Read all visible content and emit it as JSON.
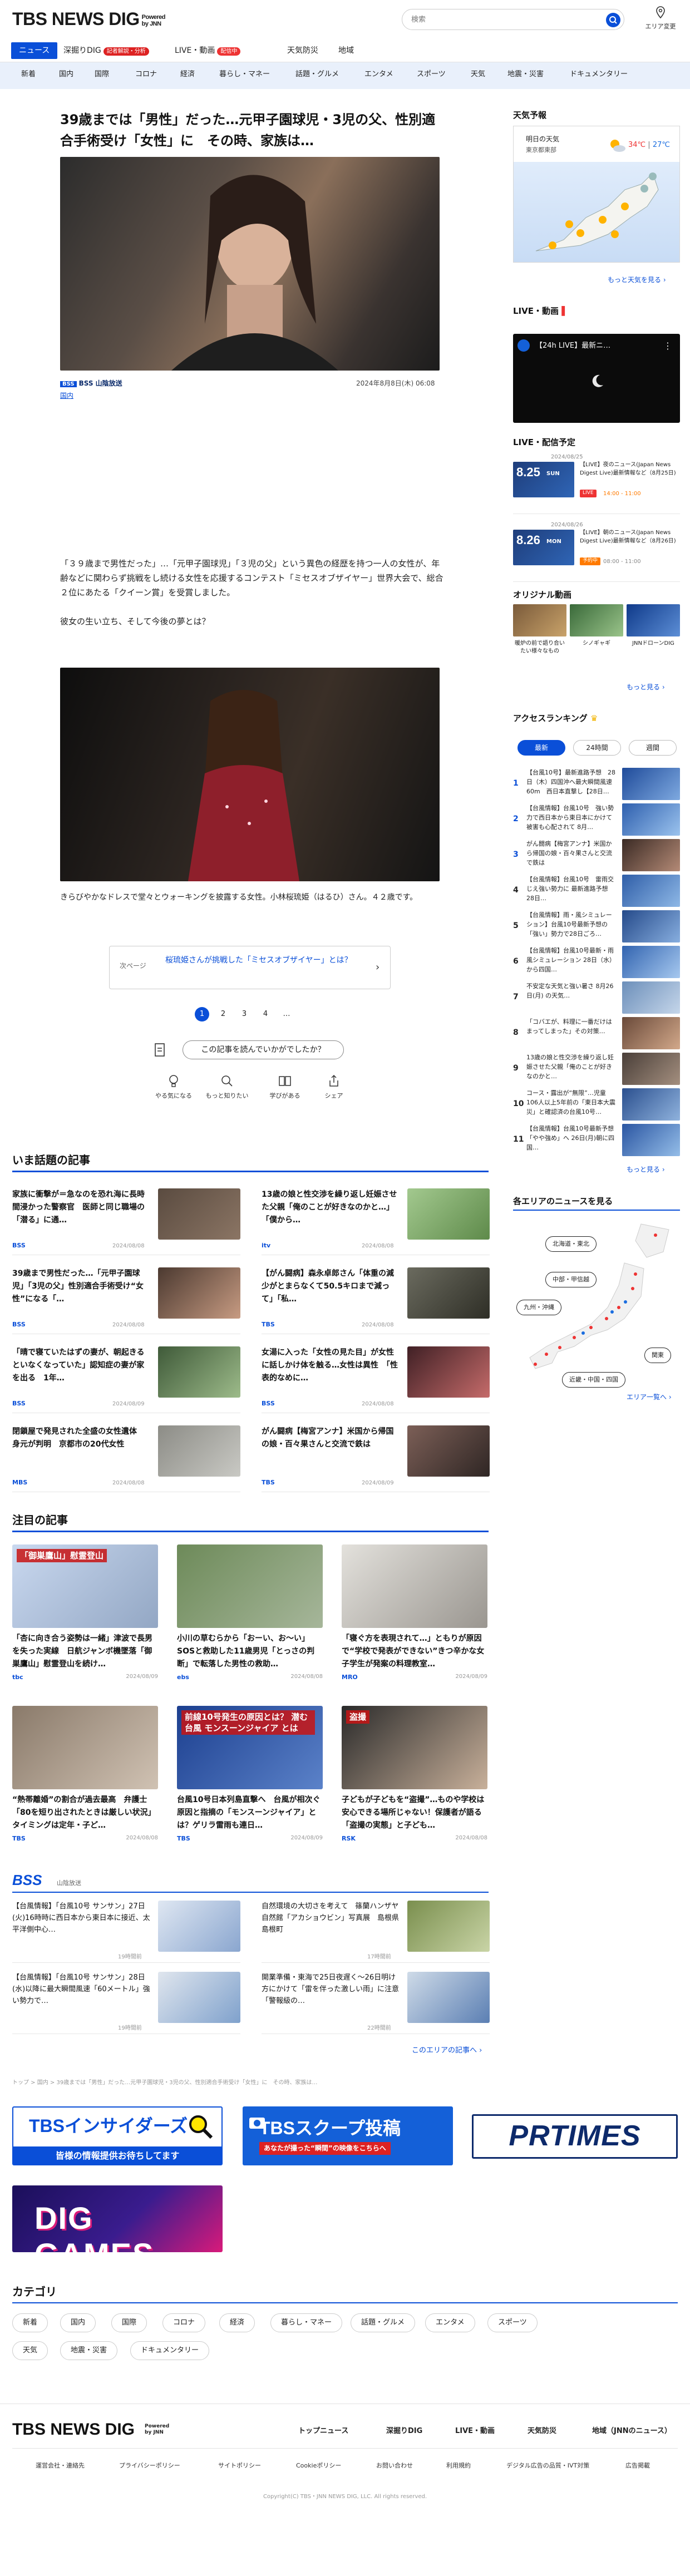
{
  "header": {
    "logo": "TBS NEWS DIG",
    "powered_1": "Powered",
    "powered_2": "by JNN",
    "search_placeholder": "検索",
    "area_label": "エリア変更"
  },
  "nav_main": {
    "items": [
      "ニュース",
      "深掘りDIG",
      "LIVE・動画",
      "天気防災",
      "地域"
    ],
    "dig_badge": "記者解説・分析",
    "live_badge": "配信中"
  },
  "nav_categories": [
    "新着",
    "国内",
    "国際",
    "コロナ",
    "経済",
    "暮らし・マネー",
    "話題・グルメ",
    "エンタメ",
    "スポーツ",
    "天気",
    "地震・災害",
    "ドキュメンタリー"
  ],
  "article": {
    "title": "39歳までは「男性」だった…元甲子園球児・3児の父、性別適合手術受け「女性」に　その時、家族は…",
    "source": "BSS 山陰放送",
    "source_logo": "BSS",
    "date": "2024年8月8日(木) 06:08",
    "category": "国内",
    "lead": "「３９歳まで男性だった」…「元甲子園球児」「３児の父」という異色の経歴を持つ一人の女性が、年齢などに関わらず挑戦をし続ける女性を応援するコンテスト「ミセスオブザイヤー」世界大会で、総合２位にあたる「クイーン賞」を受賞しました。",
    "lead2": "彼女の生い立ち、そして今後の夢とは？",
    "caption": "きらびやかなドレスで堂々とウォーキングを披露する女性。小林桜琉姫（はるひ）さん。４２歳です。",
    "next_label": "次ページ",
    "next_title": "桜琉姫さんが挑戦した「ミセスオブザイヤー」とは？",
    "pages": [
      "1",
      "2",
      "3",
      "4",
      "…"
    ],
    "react_question": "この記事を読んでいかがでしたか？",
    "reactions": [
      "やる気になる",
      "もっと知りたい",
      "学びがある",
      "シェア"
    ]
  },
  "trending": {
    "title": "いま話題の記事",
    "items": [
      {
        "title": "家族に衝撃が＝急なのを恐れ海に長時間浸かった警察官　医師と同じ職場の「潜る」に通…",
        "src": "BSS",
        "date": "2024/08/08"
      },
      {
        "title": "13歳の娘と性交渉を繰り返し妊娠させた父親「俺のことが好きなのかと…」「僕から…",
        "src": "itv",
        "date": "2024/08/08"
      },
      {
        "title": "39歳まで男性だった…「元甲子園球児」「3児の父」性別適合手術受け“女性”になる「…",
        "src": "BSS",
        "date": "2024/08/08"
      },
      {
        "title": "【がん闘病】森永卓郎さん「体重の減少がとまらなくて50.5キロまで減って」「私…",
        "src": "TBS",
        "date": "2024/08/08"
      },
      {
        "title": "「晴で寝ていたはずの妻が、朝起きるといなくなっていた」認知症の妻が家を出る　1年…",
        "src": "BSS",
        "date": "2024/08/09"
      },
      {
        "title": "女湯に入った「女性の見た目」が女性に話しかけ体を触る…女性は異性　「性表的なめに…",
        "src": "BSS",
        "date": "2024/08/08"
      },
      {
        "title": "閉鎖屋で発見された全盛の女性遺体　身元が判明　京都市の20代女性",
        "src": "MBS",
        "date": "2024/08/08"
      },
      {
        "title": "がん闘病【梅宮アンナ】米国から帰国の娘・百々果さんと交流で鉄は",
        "src": "TBS",
        "date": "2024/08/09"
      }
    ]
  },
  "featured": {
    "title": "注目の記事",
    "items": [
      {
        "title": "「杏に向き合う姿勢は一緒」津波で長男を失った実線　日航ジャンボ機墜落「御巣鷹山」慰霊登山を続け…",
        "src": "tbc",
        "date": "2024/08/09"
      },
      {
        "title": "小川の草むらから「おーい、お〜い」SOSと救助した11歳男児「とっさの判断」で転落した男性の救助…",
        "src": "ebs",
        "date": "2024/08/08"
      },
      {
        "title": "「寝ぐ方を表現されて…」ともりが原因で“学校で発表ができない”きつ辛かな女子学生が発案の料理教室…",
        "src": "MRO",
        "date": "2024/08/09"
      },
      {
        "title": "“熱帯離婚”の割合が過去最高　弁護士「80を短り出されたときは厳しい状況」タイミングは定年・子ど…",
        "src": "TBS",
        "date": "2024/08/08"
      },
      {
        "title": "台風10号日本列島直撃へ　台風が相次ぐ原因と指摘の「モンスーンジャイア」とは？ゲリラ雷雨も連日…",
        "src": "TBS",
        "date": "2024/08/09"
      },
      {
        "title": "子どもが子どもを“盗撮”…ものや学校は安心できる場所じゃない！保護者が語る「盗撮の実態」と子ども…",
        "src": "RSK",
        "date": "2024/08/08"
      }
    ],
    "img_captions": [
      "「御巣鷹山」慰霊登山",
      "",
      "",
      "",
      "前線10号発生の原因とは？ 潜む台風 モンスーンジャイア とは",
      "盗撮"
    ]
  },
  "bss": {
    "logo": "BSS",
    "label": "山陰放送",
    "items": [
      {
        "title": "【台風情報】「台風10号 サンサン」27日(火)16時時に西日本から東日本に接近、太平洋側中心…",
        "date": "19時間前"
      },
      {
        "title": "自然環境の大切さを考えて　篠蘭ハンザヤ自然館「アカショウビン」写真展　島根県島根町",
        "date": "17時間前"
      },
      {
        "title": "【台風情報】「台風10号 サンサン」28日(水)以降に最大瞬間風速「60メートル」強い勢力で…",
        "date": "19時間前"
      },
      {
        "title": "開業準備・東海で25日夜遅く〜26日明け方にかけて「雷を伴った激しい雨」に注意　「警報級の…",
        "date": "22時間前"
      }
    ],
    "more": "このエリアの記事へ"
  },
  "breadcrumb": "トップ > 国内 > 39歳までは「男性」だった…元甲子園球児・3児の父、性別適合手術受け「女性」に　その時、家族は…",
  "banners": {
    "insiders_title": "TBSインサイダーズ",
    "insiders_sub": "皆様の情報提供お待ちしてます",
    "scoop_title": "TBSスクープ投稿",
    "scoop_sub": "あなたが撮った“瞬間”の映像をこちらへ",
    "prtimes": "PRTIMES",
    "diggames": "DIG GAMES"
  },
  "categories": {
    "title": "カテゴリ",
    "row1": [
      "新着",
      "国内",
      "国際",
      "コロナ",
      "経済",
      "暮らし・マネー",
      "話題・グルメ",
      "エンタメ",
      "スポーツ"
    ],
    "row2": [
      "天気",
      "地震・災害",
      "ドキュメンタリー"
    ]
  },
  "sidebar": {
    "weather_title": "天気予報",
    "weather_day": "明日の天気",
    "weather_city": "東京都東部",
    "weather_hi": "34℃",
    "weather_lo": "27℃",
    "weather_more": "もっと天気を見る",
    "live_title": "LIVE・動画",
    "live_video_title": "【24h LIVE】最新ニ…",
    "schedule_title": "LIVE・配信予定",
    "schedule": [
      {
        "date": "8.25",
        "day": "SUN",
        "mini": "2024/08/25",
        "title": "【LIVE】夜のニュース(Japan News Digest Live)最新情報など（8月25日)",
        "badge": "LIVE",
        "time": "14:00 - 11:00"
      },
      {
        "date": "8.26",
        "day": "MON",
        "mini": "2024/08/26",
        "title": "【LIVE】朝のニュース(Japan News Digest Live)最新情報など（8月26日)",
        "badge": "予約中",
        "time": "08:00 - 11:00"
      }
    ],
    "original_title": "オリジナル動画",
    "originals": [
      "暖炉の前で語り合いたい様々なもの",
      "シノギャギ",
      "JNNドローンDIG"
    ],
    "original_more": "もっと見る",
    "ranking_title": "アクセスランキング",
    "tabs": [
      "最新",
      "24時間",
      "週間"
    ],
    "ranking": [
      "【台風10号】最新進路予想　28日（木）四国沖へ最大瞬間風速60m　西日本直撃し【28日…",
      "【台風情報】台風10号　強い勢力で西日本から東日本にかけて被害も心配されて 8月…",
      "がん闘病【梅宮アンナ】米国から帰国の娘・百々果さんと交流で鉄は",
      "【台風情報】台風10号　雷雨交じえ強い勢力に 最新進路予想 28日…",
      "【台風情報】雨・風シミュレーション】台風10号最新予想の「強い」勢力で28日ごろ…",
      "【台風情報】台風10号最新・雨風シミュレーション 28日（水）から四国…",
      "不安定な天気と強い暑さ 8月26日(月) の天気…",
      "「コバエが、料理に一番だけはまってしまった」その対策…",
      "13歳の娘と性交渉を繰り返し妊娠させた父親「俺のことが好きなのかと…",
      "コース・露出が“無限”…児童106人以上5年前の「東日本大震災」と確認済の台風10号…",
      "【台風情報】台風10号最新予想「やや強め」へ 26日(月)朝に四国…"
    ],
    "ranking_more": "もっと見る",
    "area_title": "各エリアのニュースを見る",
    "regions": [
      "北海道・東北",
      "中部・甲信越",
      "九州・沖縄",
      "関東",
      "近畿・中国・四国"
    ],
    "area_more": "エリア一覧へ"
  },
  "footer": {
    "logo": "TBS NEWS DIG",
    "powered": "Powered by JNN",
    "nav": [
      "トップニュース",
      "深掘りDIG",
      "LIVE・動画",
      "天気防災",
      "地域（JNNのニュース）"
    ],
    "links": [
      "運営会社・連絡先",
      "プライバシーポリシー",
      "サイトポリシー",
      "Cookieポリシー",
      "お問い合わせ",
      "利用規約",
      "デジタル広告の品質・IVT対策",
      "広告掲載"
    ],
    "copyright": "Copyright(C) TBS・JNN NEWS DIG, LLC. All rights reserved."
  },
  "colors": {
    "accent": "#0a4fd8",
    "nav_bg": "#e9f0fb",
    "live_red": "#e33",
    "badge_orange": "#ff7a00"
  }
}
